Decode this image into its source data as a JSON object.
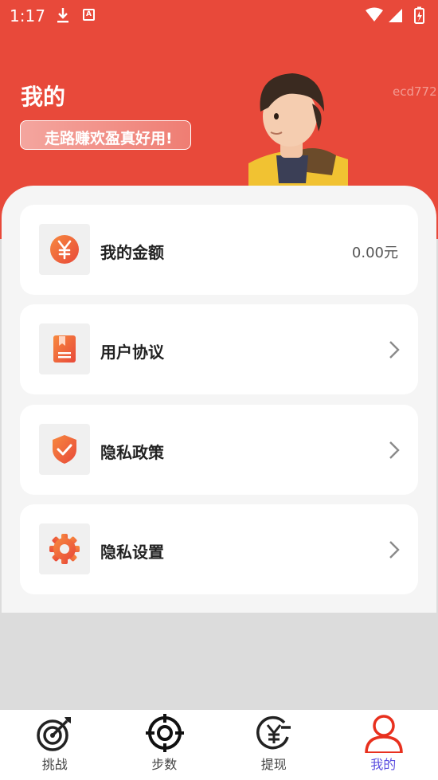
{
  "status_bar": {
    "time": "1:17"
  },
  "header": {
    "title": "我的",
    "slogan": "走路赚欢盈真好用!",
    "watermark": "ecd772"
  },
  "colors": {
    "brand": "#e8493a",
    "accent_orange": "#f26a3c",
    "tab_active": "#5b4ee0"
  },
  "menu": [
    {
      "label": "我的金额",
      "icon": "yen-coin-icon",
      "value": "0.00元"
    },
    {
      "label": "用户协议",
      "icon": "document-icon"
    },
    {
      "label": "隐私政策",
      "icon": "shield-check-icon"
    },
    {
      "label": "隐私设置",
      "icon": "gear-icon"
    }
  ],
  "tabs": [
    {
      "label": "挑战",
      "icon": "target-arrow-icon",
      "active": false
    },
    {
      "label": "步数",
      "icon": "crosshair-icon",
      "active": false
    },
    {
      "label": "提现",
      "icon": "yen-withdraw-icon",
      "active": false
    },
    {
      "label": "我的",
      "icon": "person-icon",
      "active": true
    }
  ]
}
